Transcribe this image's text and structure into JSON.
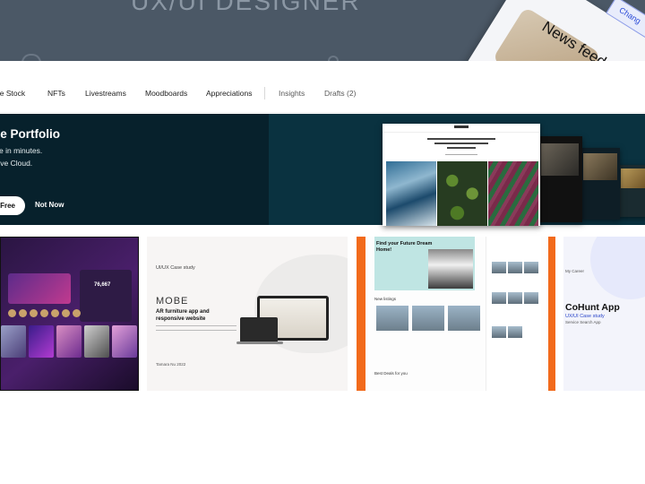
{
  "hero": {
    "title": "UX/UI DESIGNER",
    "news_feed_label": "News feed",
    "share_label": "Chang"
  },
  "nav": {
    "items": [
      {
        "label": "be Stock"
      },
      {
        "label": "NFTs"
      },
      {
        "label": "Livestreams"
      },
      {
        "label": "Moodboards"
      },
      {
        "label": "Appreciations"
      },
      {
        "label": "Insights"
      },
      {
        "label": "Drafts (2)"
      }
    ]
  },
  "banner": {
    "title": "be Portfolio",
    "line1": "e in minutes.",
    "line2": "tive Cloud.",
    "primary_button": "Free",
    "secondary_button": "Not Now",
    "mockup_heading": "My name is Tim Hagen, I work as a Photographer and Designer in Munich, Germany"
  },
  "projects": [
    {
      "name": "nft-dashboard",
      "value": "76,667"
    },
    {
      "name": "mobe",
      "case_label": "UI/UX Case study",
      "logo": "MOBE",
      "line1": "AR furniture app and",
      "line2": "responsive website",
      "footer": "Tamara Nu    2022"
    },
    {
      "name": "real-estate",
      "hero_line1": "Find your Future Dream",
      "hero_line2": "Home!",
      "section1": "New listings",
      "section2": "Best Deals for you"
    },
    {
      "name": "cohunt",
      "small": "My Career",
      "title": "CoHunt App",
      "subtitle": "UX/UI Case study",
      "subtitle2": "Service Search App"
    }
  ],
  "colors": {
    "hero_bg": "#4b5866",
    "banner_bg": "#07212c",
    "accent_orange": "#f26a1b",
    "accent_blue": "#2a45c9"
  }
}
